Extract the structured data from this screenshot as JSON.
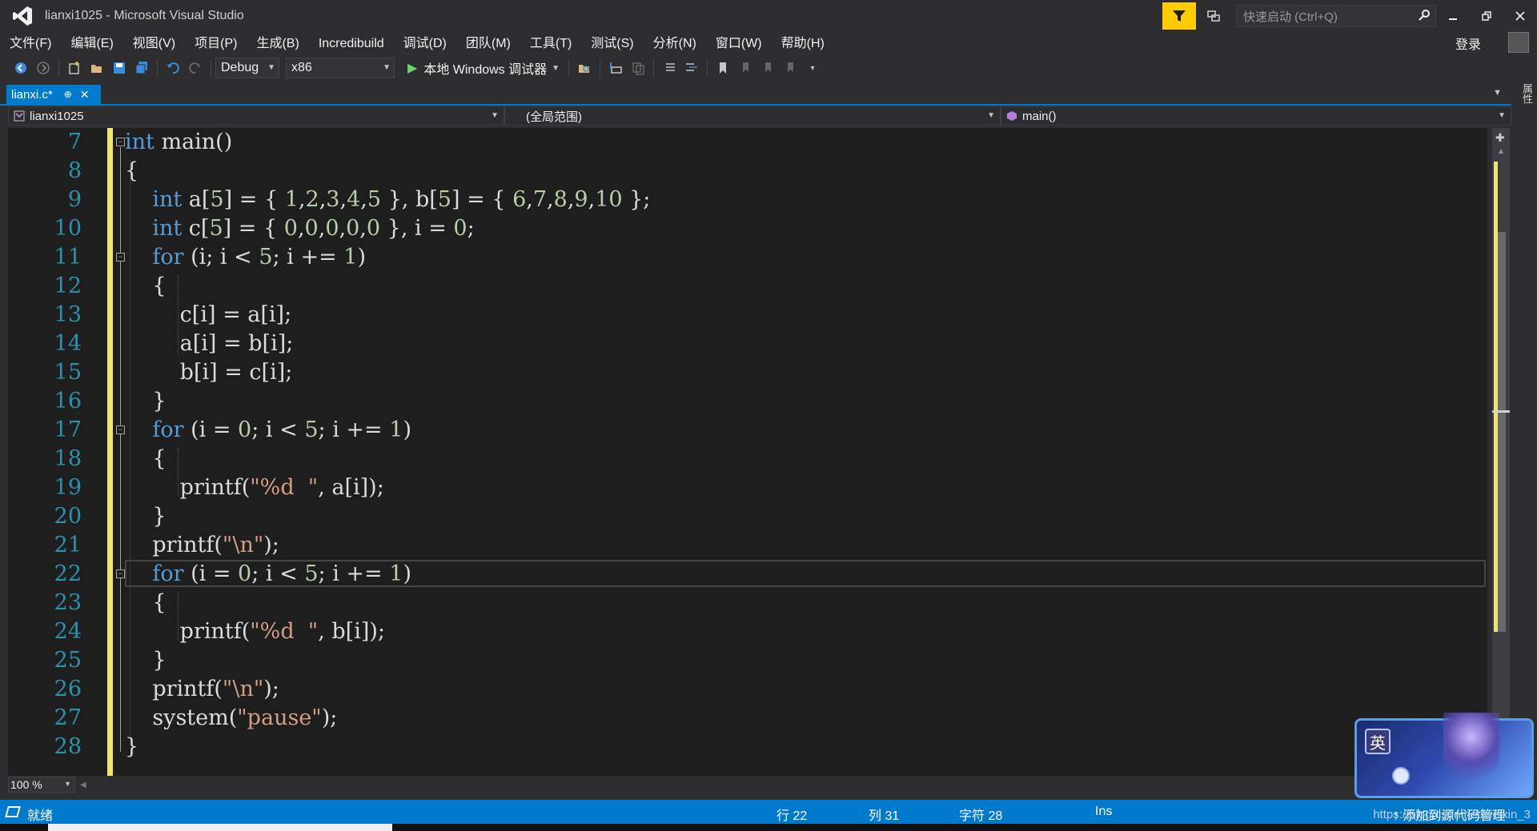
{
  "window": {
    "title": "lianxi1025 - Microsoft Visual Studio",
    "quick_launch_placeholder": "快速启动 (Ctrl+Q)"
  },
  "menu": [
    "文件(F)",
    "编辑(E)",
    "视图(V)",
    "项目(P)",
    "生成(B)",
    "Incredibuild",
    "调试(D)",
    "团队(M)",
    "工具(T)",
    "测试(S)",
    "分析(N)",
    "窗口(W)",
    "帮助(H)"
  ],
  "login_label": "登录",
  "toolbar": {
    "configuration": "Debug",
    "platform": "x86",
    "run_label": "本地 Windows 调试器"
  },
  "tab": {
    "filename": "lianxi.c*",
    "pin_icon": "pin-icon",
    "close_icon": "close-icon"
  },
  "side_panel_label": "属性",
  "navbar": {
    "project": "lianxi1025",
    "scope": "(全局范围)",
    "member": "main()"
  },
  "editor": {
    "line_numbers": [
      "7",
      "8",
      "9",
      "10",
      "11",
      "12",
      "13",
      "14",
      "15",
      "16",
      "17",
      "18",
      "19",
      "20",
      "21",
      "22",
      "23",
      "24",
      "25",
      "26",
      "27",
      "28"
    ],
    "current_line_number": "22",
    "colors": {
      "keyword": "#569cd6",
      "number": "#b5cea8",
      "string": "#d69d85",
      "text": "#dcdcdc",
      "line_number": "#2b91af",
      "change_bar": "#efe475",
      "background": "#1e1e1e"
    }
  },
  "zoom_level": "100 %",
  "status": {
    "ready": "就绪",
    "row": "行 22",
    "col": "列 31",
    "char": "字符 28",
    "mode": "Ins",
    "source_control": "添加到源代码管理"
  },
  "watermark": "https://blog.csdn.net/weixin_",
  "watermark_tail": "3",
  "overlay_badge": "英",
  "colors": {
    "accent": "#007acc",
    "filter_button": "#ffcc00"
  }
}
